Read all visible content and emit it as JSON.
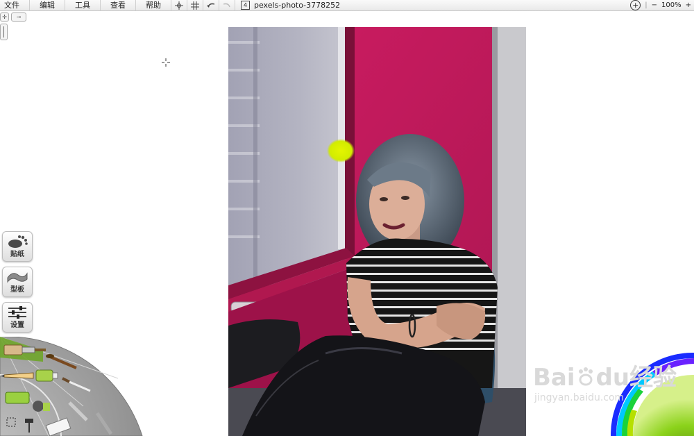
{
  "menubar": {
    "items": [
      "文件",
      "编辑",
      "工具",
      "查看",
      "帮助"
    ],
    "document_number": "4",
    "document_title": "pexels-photo-3778252",
    "zoom": "100%"
  },
  "side_panel": {
    "stickers_label": "贴纸",
    "stencils_label": "型板",
    "settings_label": "设置"
  },
  "tool_wheel": {
    "tools": [
      "paint-brush",
      "round-brush",
      "pencil",
      "paint-tube",
      "palette-knife",
      "fill-bucket",
      "select-tool",
      "roller"
    ],
    "accent_color": "#6fa52a"
  },
  "canvas": {
    "wall_color": "#c4195c",
    "brush_stroke_color": "#d7f000"
  },
  "color_picker": {
    "current_color": "#8bd21a"
  },
  "watermark": {
    "brand": "Bai",
    "brand_suffix": "du",
    "product": "经验",
    "url": "jingyan.baidu.com"
  }
}
